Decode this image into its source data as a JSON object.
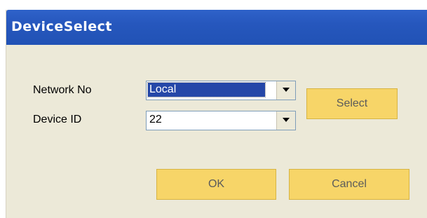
{
  "window": {
    "title": "DeviceSelect"
  },
  "form": {
    "network_label": "Network No",
    "network_value": "Local",
    "device_label": "Device ID",
    "device_value": "22"
  },
  "buttons": {
    "select": "Select",
    "ok": "OK",
    "cancel": "Cancel"
  },
  "icons": {
    "dropdown": "chevron-down-icon"
  },
  "colors": {
    "titlebar": "#2152b5",
    "button_fill": "#f7d568",
    "dialog_bg": "#ece9d8",
    "selection": "#2447a8"
  }
}
